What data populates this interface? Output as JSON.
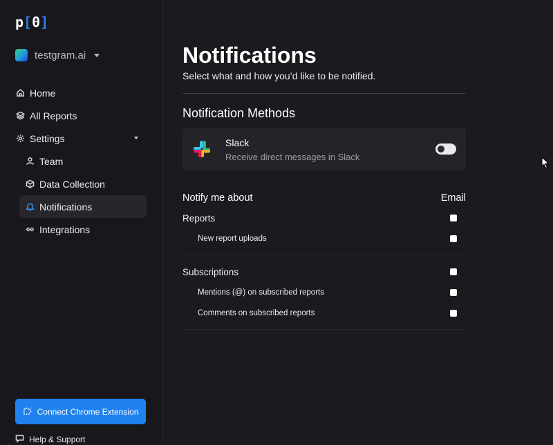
{
  "brand": {
    "logo_text": "p",
    "logo_bracket_l": "[",
    "logo_digit": "0",
    "logo_bracket_r": "]"
  },
  "workspace": {
    "name": "testgram.ai"
  },
  "sidebar": {
    "items": [
      {
        "label": "Home",
        "icon": "home-icon"
      },
      {
        "label": "All Reports",
        "icon": "layers-icon"
      },
      {
        "label": "Settings",
        "icon": "gear-icon"
      }
    ],
    "settings_children": [
      {
        "label": "Team",
        "icon": "user-icon"
      },
      {
        "label": "Data Collection",
        "icon": "cube-icon"
      },
      {
        "label": "Notifications",
        "icon": "bell-icon",
        "active": true
      },
      {
        "label": "Integrations",
        "icon": "link-icon"
      }
    ],
    "cta_label": "Connect Chrome Extension",
    "help_label": "Help & Support"
  },
  "page": {
    "title": "Notifications",
    "subtitle": "Select what and how you’d like to be notified."
  },
  "methods": {
    "heading": "Notification Methods",
    "slack": {
      "name": "Slack",
      "description": "Receive direct messages in Slack",
      "enabled": false
    }
  },
  "notify": {
    "heading": "Notify me about",
    "column": "Email",
    "groups": [
      {
        "label": "Reports",
        "children": [
          "New report uploads"
        ]
      },
      {
        "label": "Subscriptions",
        "children": [
          "Mentions (@) on subscribed reports",
          "Comments on subscribed reports"
        ]
      }
    ]
  },
  "colors": {
    "accent": "#1f82ee",
    "background": "#1b1a1f",
    "sidebar": "#18171c",
    "card": "#242328"
  }
}
